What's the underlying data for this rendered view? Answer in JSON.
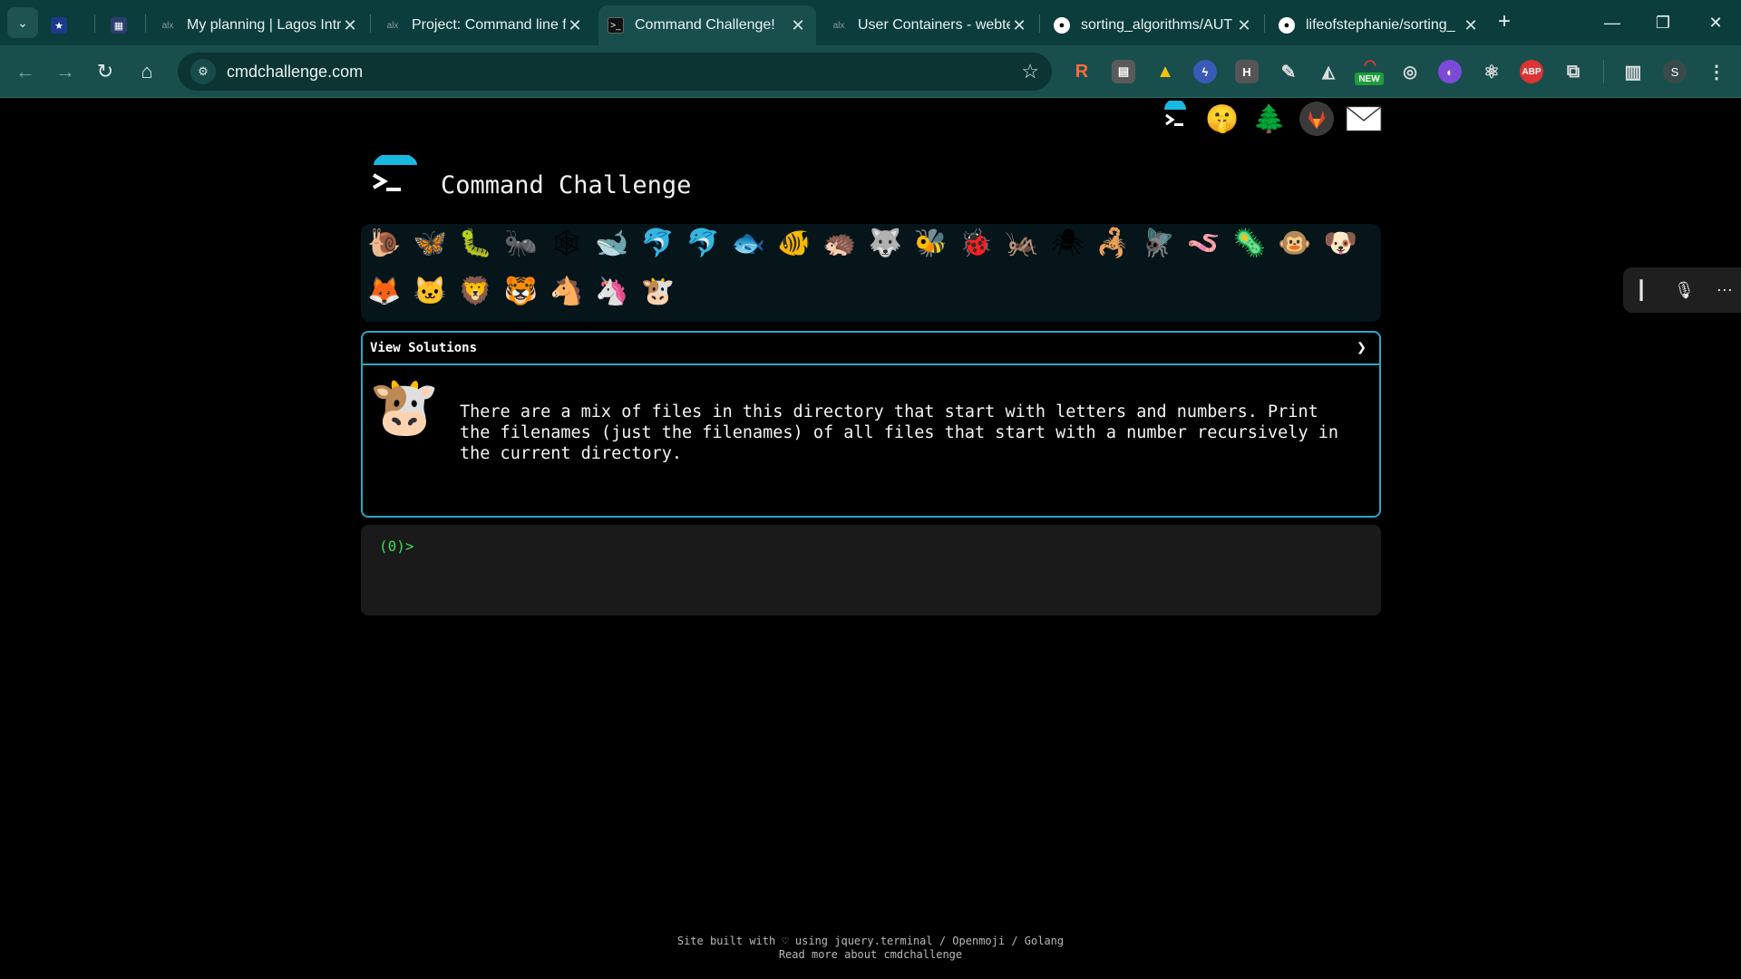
{
  "browser": {
    "tabs": [
      {
        "title": "",
        "favicon": "star-icon"
      },
      {
        "title": "",
        "favicon": "calendar-icon"
      },
      {
        "title": "My planning | Lagos Intr",
        "favicon": "alx-icon"
      },
      {
        "title": "Project: Command line f",
        "favicon": "alx-icon"
      },
      {
        "title": "Command Challenge!",
        "favicon": "terminal-icon",
        "active": true
      },
      {
        "title": "User Containers - webte",
        "favicon": "alx-icon"
      },
      {
        "title": "sorting_algorithms/AUT",
        "favicon": "github-icon"
      },
      {
        "title": "lifeofstephanie/sorting_",
        "favicon": "github-icon"
      }
    ],
    "url": "cmdchallenge.com",
    "extension_badge": "NEW",
    "extension_abp": "ABP",
    "extension_h": "H",
    "profile_initial": "S"
  },
  "header": {
    "title": "Command Challenge",
    "top_icons": [
      "terminal-logo-icon",
      "shushing-face-icon",
      "tree-icon",
      "gitlab-icon",
      "envelope-icon"
    ]
  },
  "levels": {
    "row1": [
      "🐌",
      "🦋",
      "🐛",
      "🐜",
      "🕸",
      "🐋",
      "🐬",
      "🐬",
      "🐟",
      "🐠",
      "🦔",
      "🐺",
      "🐝",
      "🐞",
      "🦗",
      "🕷",
      "🦂",
      "🪰",
      "🪱",
      "🦠",
      "🐵",
      "🐶"
    ],
    "row2": [
      "🦊",
      "🐱",
      "🦁",
      "🐯",
      "🐴",
      "🦄",
      "🐮"
    ]
  },
  "challenge": {
    "solutions_label": "View Solutions",
    "text": "There are a mix of files in this directory that start with letters and numbers. Print the filenames (just the filenames) of all files that start with a number recursively in the current directory.",
    "icon": "🐮"
  },
  "terminal": {
    "prompt_code": "(0)",
    "prompt_symbol": ">"
  },
  "footer": {
    "line1": "Site built with ♡ using jquery.terminal / Openmoji / Golang",
    "line2": "Read more about cmdchallenge"
  }
}
